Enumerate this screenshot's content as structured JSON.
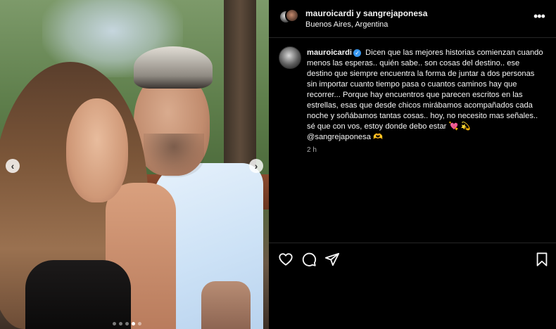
{
  "post": {
    "header": {
      "names": "mauroicardi y sangrejaponesa",
      "location": "Buenos Aires, Argentina",
      "more_icon": "more-horizontal-icon"
    },
    "caption": {
      "username": "mauroicardi",
      "verified": true,
      "text_main": "Dicen que las mejores historias comienzan cuando menos las esperas.. quién sabe.. son cosas del destino.. ese destino que siempre encuentra la forma de juntar a dos personas sin importar cuanto tiempo pasa o cuantos caminos hay que recorrer... Porque hay encuentros que parecen escritos en las estrellas, esas que desde chicos mirábamos acompañados cada noche y soñábamos tantas cosas.. hoy, no necesito mas señales.. sé que con vos, estoy donde debo estar",
      "emoji_heart": "💘",
      "emoji_spark": "💫",
      "mention": "@sangrejaponesa",
      "emoji_hands": "🫶",
      "time": "2 h"
    },
    "media": {
      "prev_icon": "‹",
      "next_icon": "›",
      "dots_count": 5,
      "active_dot": 3
    },
    "actions": {
      "like_icon": "heart-icon",
      "comment_icon": "comment-icon",
      "share_icon": "share-icon",
      "save_icon": "bookmark-icon"
    }
  }
}
